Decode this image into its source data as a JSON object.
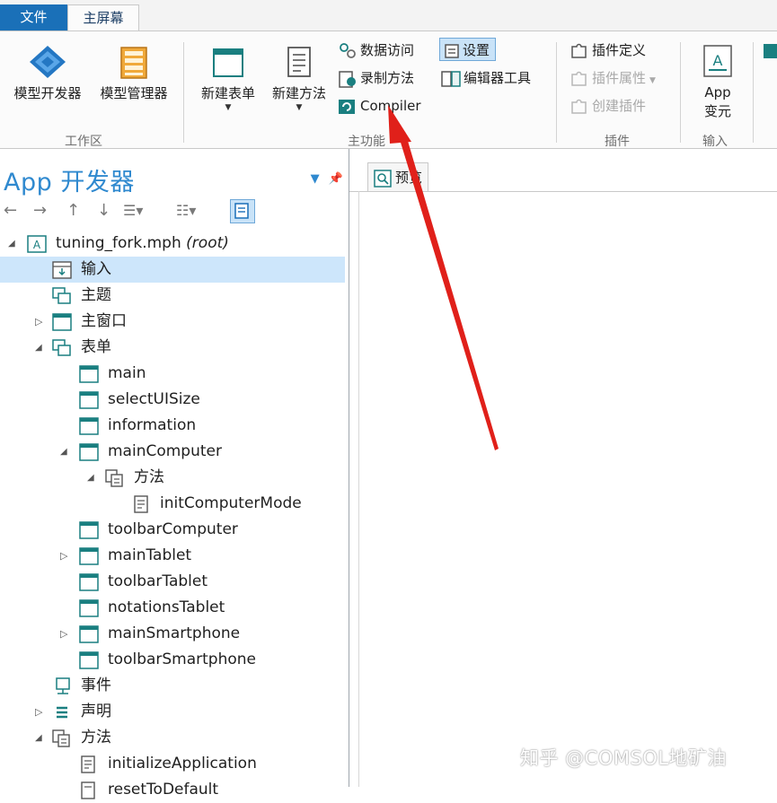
{
  "tabs": {
    "file": "文件",
    "home": "主屏幕"
  },
  "ribbon": {
    "workspace": {
      "model_builder": "模型开发器",
      "model_manager": "模型管理器",
      "group_label": "工作区"
    },
    "main": {
      "new_form": "新建表单",
      "new_method": "新建方法",
      "data_access": "数据访问",
      "record_method": "录制方法",
      "compiler": "Compiler",
      "settings": "设置",
      "editor_tools": "编辑器工具",
      "group_label": "主功能"
    },
    "plugins": {
      "plugin_definition": "插件定义",
      "plugin_properties": "插件属性",
      "create_plugin": "创建插件",
      "group_label": "插件"
    },
    "input": {
      "app_variables_line1": "App",
      "app_variables_line2": "变元",
      "group_label": "输入"
    }
  },
  "panel": {
    "title": "App 开发器",
    "tree": [
      {
        "label": "tuning_fork.mph",
        "suffix": "(root)"
      },
      {
        "label": "输入"
      },
      {
        "label": "主题"
      },
      {
        "label": "主窗口"
      },
      {
        "label": "表单"
      },
      {
        "label": "main"
      },
      {
        "label": "selectUISize"
      },
      {
        "label": "information"
      },
      {
        "label": "mainComputer"
      },
      {
        "label": "方法"
      },
      {
        "label": "initComputerMode"
      },
      {
        "label": "toolbarComputer"
      },
      {
        "label": "mainTablet"
      },
      {
        "label": "toolbarTablet"
      },
      {
        "label": "notationsTablet"
      },
      {
        "label": "mainSmartphone"
      },
      {
        "label": "toolbarSmartphone"
      },
      {
        "label": "事件"
      },
      {
        "label": "声明"
      },
      {
        "label": "方法"
      },
      {
        "label": "initializeApplication"
      },
      {
        "label": "resetToDefault"
      }
    ]
  },
  "preview_tab": "预览",
  "watermark": "知乎 @COMSOL地矿油",
  "colors": {
    "accent": "#2f89cf",
    "file_tab": "#1a70b8",
    "selection": "#cde6fb",
    "arrow": "#e0201a"
  }
}
